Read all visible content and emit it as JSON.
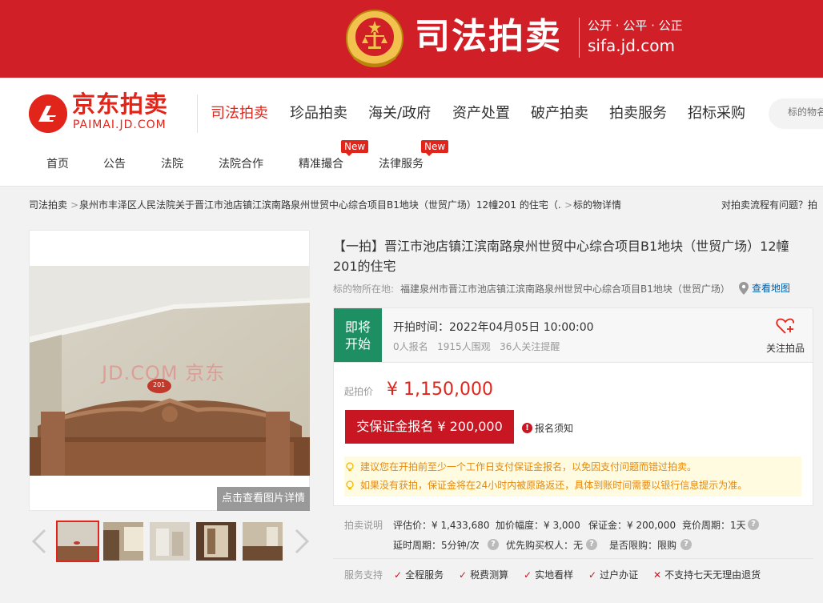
{
  "banner": {
    "title": "司法拍卖",
    "slogan": "公开 · 公平 · 公正",
    "url": "sifa.jd.com",
    "color": "#d01f27"
  },
  "logo": {
    "name": "京东拍卖",
    "domain": "PAIMAI.JD.COM"
  },
  "main_nav": [
    "司法拍卖",
    "珍品拍卖",
    "海关/政府",
    "资产处置",
    "破产拍卖",
    "拍卖服务",
    "招标采购"
  ],
  "search": {
    "placeholder": "标的物名"
  },
  "sub_nav": {
    "items": [
      "首页",
      "公告",
      "法院",
      "法院合作",
      "精准撮合",
      "法律服务"
    ],
    "badge": "New"
  },
  "breadcrumb": {
    "items": [
      "司法拍卖",
      "泉州市丰泽区人民法院关于晋江市池店镇江滨南路泉州世贸中心综合项目B1地块（世贸广场）12幢201 的住宅（...",
      "标的物详情"
    ],
    "help": "对拍卖流程有问题？拍"
  },
  "gallery": {
    "watermark": "JD.COM 京东",
    "door_number": "201",
    "view_detail": "点击查看图片详情"
  },
  "item": {
    "title": "【一拍】晋江市池店镇江滨南路泉州世贸中心综合项目B1地块（世贸广场）12幢201的住宅",
    "location_label": "标的物所在地:",
    "location": "福建泉州市晋江市池店镇江滨南路泉州世贸中心综合项目B1地块（世贸广场）...",
    "map_link": "查看地图"
  },
  "auction": {
    "status": "即将开始",
    "status_line1": "即将",
    "status_line2": "开始",
    "start_time": "开拍时间：2022年04月05日 10:00:00",
    "signups": "0人报名",
    "views": "1915人围观",
    "reminders": "36人关注提醒",
    "follow_label": "关注拍品",
    "price_label": "起拍价",
    "price": "¥ 1,150,000",
    "deposit_button": "交保证金报名 ¥ 200,000",
    "notice_icon": "!",
    "notice": "报名须知",
    "tips": [
      "建议您在开拍前至少一个工作日支付保证金报名，以免因支付问题而错过拍卖。",
      "如果没有获拍，保证金将在24小时内被原路返还，具体到账时间需要以银行信息提示为准。"
    ]
  },
  "details": {
    "label": "拍卖说明",
    "row1": [
      "评估价：¥ 1,433,680",
      "加价幅度：¥ 3,000",
      "保证金：¥ 200,000",
      "竞价周期：1天"
    ],
    "row2": [
      "延时周期：5分钟/次",
      "优先购买权人：无",
      "是否限购：限购"
    ],
    "q": "?"
  },
  "services": {
    "label": "服务支持",
    "items": [
      "全程服务",
      "税费测算",
      "实地看样",
      "过户办证",
      "不支持七天无理由退货"
    ],
    "check": "✓",
    "cross": "✕"
  },
  "colors": {
    "brand_red": "#e1251b",
    "button_red": "#c81623",
    "status_green": "#1d8f62",
    "tip_orange": "#e8890c"
  }
}
